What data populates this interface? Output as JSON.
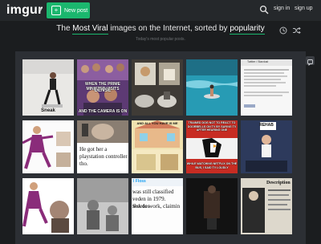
{
  "app": {
    "logo": "imgur",
    "new_post_label": "New post",
    "sign_in": "sign in",
    "sign_up": "sign up"
  },
  "headline": {
    "prefix": "The",
    "sort_mode": "Most Viral",
    "middle": "images on the Internet, sorted by",
    "sort_by": "popularity",
    "subtitle": "Today's most popular posts."
  },
  "icons": {
    "search": "search-icon",
    "time": "clock-icon",
    "shuffle": "shuffle-icon",
    "chat": "chat-icon",
    "caret": "chevron-down-icon"
  },
  "colors": {
    "accent": "#1bb76e",
    "topbar": "#25282b",
    "background": "#1b1d1f",
    "panel": "#2c2f34"
  },
  "posts": [
    {
      "id": "p1",
      "caption": "Sneak"
    },
    {
      "id": "p2",
      "caption_top": "WHEN THE PRIME MINISTER VISITS",
      "caption_mid": "DENSE",
      "caption_bot": "AND THE CAMERA IS ON"
    },
    {
      "id": "p3",
      "caption": ""
    },
    {
      "id": "p4",
      "caption": ""
    },
    {
      "id": "p5",
      "caption": "Twitter / Stardust"
    },
    {
      "id": "p6",
      "caption": ""
    },
    {
      "id": "p7",
      "caption": "He got her a playstation controller tho."
    },
    {
      "id": "p8",
      "caption": "AND ALL YOU HAVE IS ME"
    },
    {
      "id": "p9",
      "caption_top": "TRAINED DOG NOT TO REACT TO DOORBELLS ON TV BY SAYING TV AFTER HEARING ONE",
      "caption_bot": "WHILE WATCHING NETFLIX ON THE BUS, I SAID TV LOUDLY"
    },
    {
      "id": "p10",
      "caption": "REHAB"
    },
    {
      "id": "p11",
      "caption": ""
    },
    {
      "id": "p12",
      "caption": ""
    },
    {
      "id": "p13",
      "caption_a": "l Floss",
      "caption_b": "was still classified",
      "caption_c": "veden in 1979. Swedes",
      "caption_d": "sick to work, claimin"
    },
    {
      "id": "p14",
      "caption": ""
    },
    {
      "id": "p15",
      "caption": ""
    },
    {
      "id": "p16",
      "caption": "Description"
    }
  ]
}
